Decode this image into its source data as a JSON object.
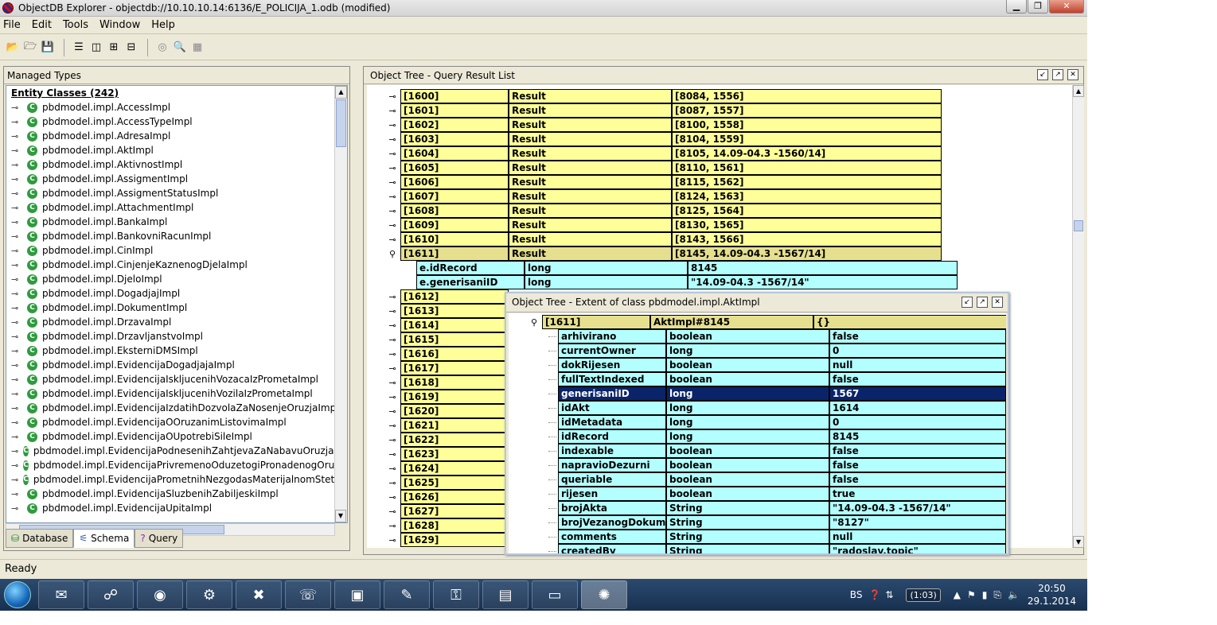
{
  "window": {
    "title": "ObjectDB Explorer - objectdb://10.10.10.14:6136/E_POLICIJA_1.odb (modified)",
    "minimize": "▁",
    "maximize": "❐",
    "close": "✕"
  },
  "menu": {
    "file": "File",
    "edit": "Edit",
    "tools": "Tools",
    "window": "Window",
    "help": "Help"
  },
  "left": {
    "title": "Managed Types",
    "header": "Entity Classes (242)",
    "items": [
      "pbdmodel.impl.AccessImpl",
      "pbdmodel.impl.AccessTypeImpl",
      "pbdmodel.impl.AdresaImpl",
      "pbdmodel.impl.AktImpl",
      "pbdmodel.impl.AktivnostImpl",
      "pbdmodel.impl.AssigmentImpl",
      "pbdmodel.impl.AssigmentStatusImpl",
      "pbdmodel.impl.AttachmentImpl",
      "pbdmodel.impl.BankaImpl",
      "pbdmodel.impl.BankovniRacunImpl",
      "pbdmodel.impl.CinImpl",
      "pbdmodel.impl.CinjenjeKaznenogDjelaImpl",
      "pbdmodel.impl.DjeloImpl",
      "pbdmodel.impl.DogadjajImpl",
      "pbdmodel.impl.DokumentImpl",
      "pbdmodel.impl.DrzavaImpl",
      "pbdmodel.impl.DrzavljanstvoImpl",
      "pbdmodel.impl.EksterniDMSImpl",
      "pbdmodel.impl.EvidencijaDogadjajaImpl",
      "pbdmodel.impl.EvidencijaIskljucenihVozacaIzPrometaImpl",
      "pbdmodel.impl.EvidencijaIskljucenihVozilaIzPrometaImpl",
      "pbdmodel.impl.EvidencijaIzdatihDozvolaZaNosenjeOruzjaImpl",
      "pbdmodel.impl.EvidencijaOOruzanimListovimaImpl",
      "pbdmodel.impl.EvidencijaOUpotrebiSileImpl",
      "pbdmodel.impl.EvidencijaPodnesenihZahtjevaZaNabavuOruzjaImpl",
      "pbdmodel.impl.EvidencijaPrivremenoOduzetogiPronadenogOruzjaIm",
      "pbdmodel.impl.EvidencijaPrometnihNezgodasMaterijalnomStetomIm",
      "pbdmodel.impl.EvidencijaSluzbenihZabiljeskiImpl",
      "pbdmodel.impl.EvidencijaUpitaImpl"
    ],
    "tabs": [
      "Database",
      "Schema",
      "Query"
    ]
  },
  "main": {
    "title": "Object Tree - Query Result List",
    "results": [
      {
        "id": "[1600]",
        "label": "Result",
        "value": "[8084, 1556]"
      },
      {
        "id": "[1601]",
        "label": "Result",
        "value": "[8087, 1557]"
      },
      {
        "id": "[1602]",
        "label": "Result",
        "value": "[8100, 1558]"
      },
      {
        "id": "[1603]",
        "label": "Result",
        "value": "[8104, 1559]"
      },
      {
        "id": "[1604]",
        "label": "Result",
        "value": "[8105, 14.09-04.3 -1560/14]"
      },
      {
        "id": "[1605]",
        "label": "Result",
        "value": "[8110, 1561]"
      },
      {
        "id": "[1606]",
        "label": "Result",
        "value": "[8115, 1562]"
      },
      {
        "id": "[1607]",
        "label": "Result",
        "value": "[8124, 1563]"
      },
      {
        "id": "[1608]",
        "label": "Result",
        "value": "[8125, 1564]"
      },
      {
        "id": "[1609]",
        "label": "Result",
        "value": "[8130, 1565]"
      },
      {
        "id": "[1610]",
        "label": "Result",
        "value": "[8143, 1566]"
      },
      {
        "id": "[1611]",
        "label": "Result",
        "value": "[8145, 14.09-04.3 -1567/14]"
      }
    ],
    "expanded": [
      {
        "name": "e.idRecord",
        "type": "long",
        "value": "8145"
      },
      {
        "name": "e.generisaniID",
        "type": "long",
        "value": "\"14.09-04.3 -1567/14\""
      }
    ],
    "more_ids": [
      "[1612]",
      "[1613]",
      "[1614]",
      "[1615]",
      "[1616]",
      "[1617]",
      "[1618]",
      "[1619]",
      "[1620]",
      "[1621]",
      "[1622]",
      "[1623]",
      "[1624]",
      "[1625]",
      "[1626]",
      "[1627]",
      "[1628]",
      "[1629]"
    ]
  },
  "extent": {
    "title": "Object Tree - Extent of class pbdmodel.impl.AktImpl",
    "root": {
      "id": "[1611]",
      "label": "AktImpl#8145",
      "value": "{}"
    },
    "fields": [
      {
        "name": "arhivirano",
        "type": "boolean",
        "value": "false"
      },
      {
        "name": "currentOwner",
        "type": "long",
        "value": "0"
      },
      {
        "name": "dokRijesen",
        "type": "boolean",
        "value": "null"
      },
      {
        "name": "fullTextIndexed",
        "type": "boolean",
        "value": "false"
      },
      {
        "name": "generisaniID",
        "type": "long",
        "value": "1567"
      },
      {
        "name": "idAkt",
        "type": "long",
        "value": "1614"
      },
      {
        "name": "idMetadata",
        "type": "long",
        "value": "0"
      },
      {
        "name": "idRecord",
        "type": "long",
        "value": "8145"
      },
      {
        "name": "indexable",
        "type": "boolean",
        "value": "false"
      },
      {
        "name": "napravioDezurni",
        "type": "boolean",
        "value": "false"
      },
      {
        "name": "queriable",
        "type": "boolean",
        "value": "false"
      },
      {
        "name": "rijesen",
        "type": "boolean",
        "value": "true"
      },
      {
        "name": "brojAkta",
        "type": "String",
        "value": "\"14.09-04.3 -1567/14\""
      },
      {
        "name": "brojVezanogDokume...",
        "type": "String",
        "value": "\"8127\""
      },
      {
        "name": "comments",
        "type": "String",
        "value": "null"
      },
      {
        "name": "createdBy",
        "type": "String",
        "value": "\"radoslav.topic\""
      }
    ],
    "selected_field": "generisaniID"
  },
  "status": "Ready",
  "taskbar": {
    "lang": "BS",
    "battery": "(1:03)",
    "time": "20:50",
    "date": "29.1.2014"
  }
}
